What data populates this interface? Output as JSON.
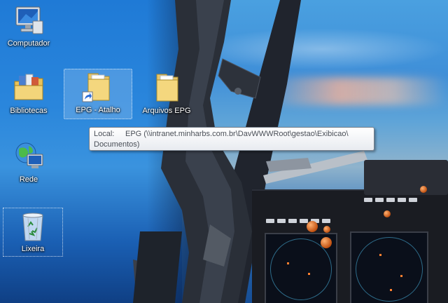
{
  "desktop": {
    "icons": [
      {
        "label": "Computador",
        "icon": "computer-icon"
      },
      {
        "label": "Bibliotecas",
        "icon": "libraries-icon"
      },
      {
        "label": "EPG - Atalho",
        "icon": "folder-shortcut-icon"
      },
      {
        "label": "Arquivos EPG",
        "icon": "folder-icon"
      },
      {
        "label": "Rede",
        "icon": "network-icon"
      },
      {
        "label": "Lixeira",
        "icon": "recycle-bin-icon"
      }
    ]
  },
  "tooltip": {
    "key": "Local:",
    "value_line1": "EPG (\\\\intranet.minharbs.com.br\\DavWWWRoot\\gestao\\Exibicao\\",
    "value_line2": "Documentos)"
  },
  "colors": {
    "selection": "#a0c8f0",
    "label_text": "#ffffff",
    "tooltip_text": "#4a4f57"
  }
}
